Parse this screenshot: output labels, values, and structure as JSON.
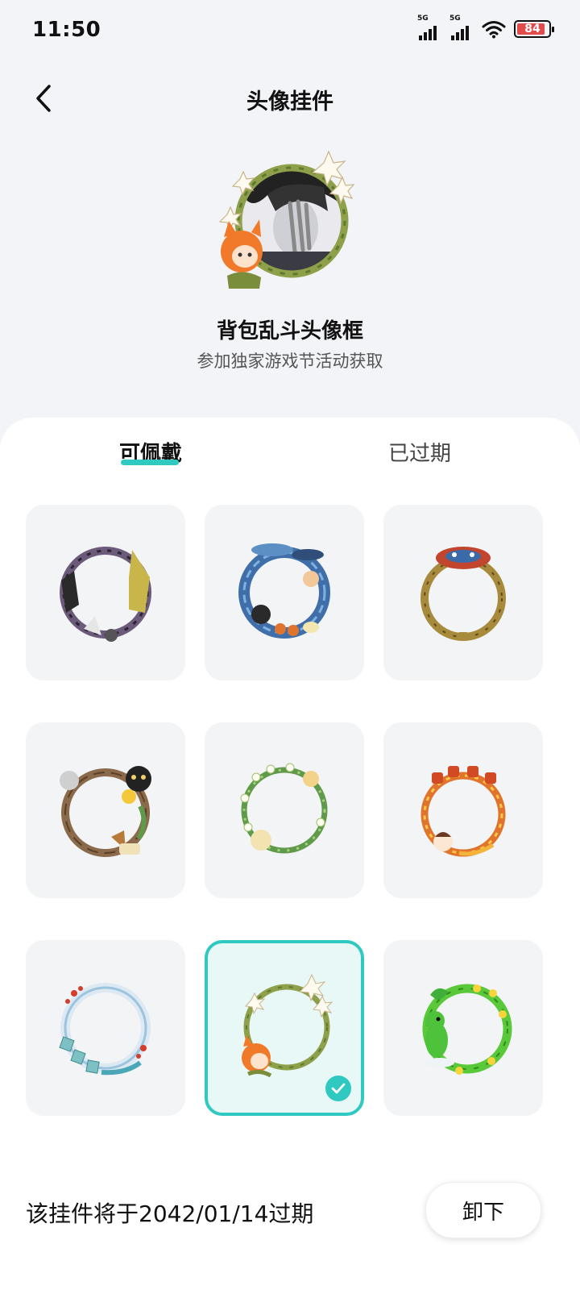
{
  "status_bar": {
    "time": "11:50",
    "signal_1_label": "5G",
    "signal_2_label": "5G",
    "battery_level": "84"
  },
  "header": {
    "title": "头像挂件",
    "back_icon": "chevron-left-icon"
  },
  "current_pendant": {
    "name": "背包乱斗头像框",
    "description": "参加独家游戏节活动获取"
  },
  "tabs": [
    {
      "label": "可佩戴",
      "active": true
    },
    {
      "label": "已过期",
      "active": false
    }
  ],
  "pendants": [
    {
      "theme": "purple-dark-ring",
      "color": "#6b5a7a",
      "selected": false
    },
    {
      "theme": "blue-fish-ring",
      "color": "#3f6ea8",
      "selected": false
    },
    {
      "theme": "golden-ring-crab",
      "color": "#a88a3c",
      "selected": false
    },
    {
      "theme": "wooden-branch-ring",
      "color": "#8a6a4a",
      "selected": false
    },
    {
      "theme": "green-vine-ring",
      "color": "#5f9a4a",
      "selected": false
    },
    {
      "theme": "orange-festival-ring",
      "color": "#e0742c",
      "selected": false
    },
    {
      "theme": "snow-plum-ring",
      "color": "#9cc4de",
      "selected": false
    },
    {
      "theme": "lily-vine-ring",
      "color": "#7f9a45",
      "selected": true
    },
    {
      "theme": "green-dino-ring",
      "color": "#59c93a",
      "selected": false
    }
  ],
  "footer": {
    "expiry_text": "该挂件将于2042/01/14过期",
    "unwear_label": "卸下"
  },
  "colors": {
    "accent": "#2fc9c1",
    "battery": "#e14b4b"
  }
}
